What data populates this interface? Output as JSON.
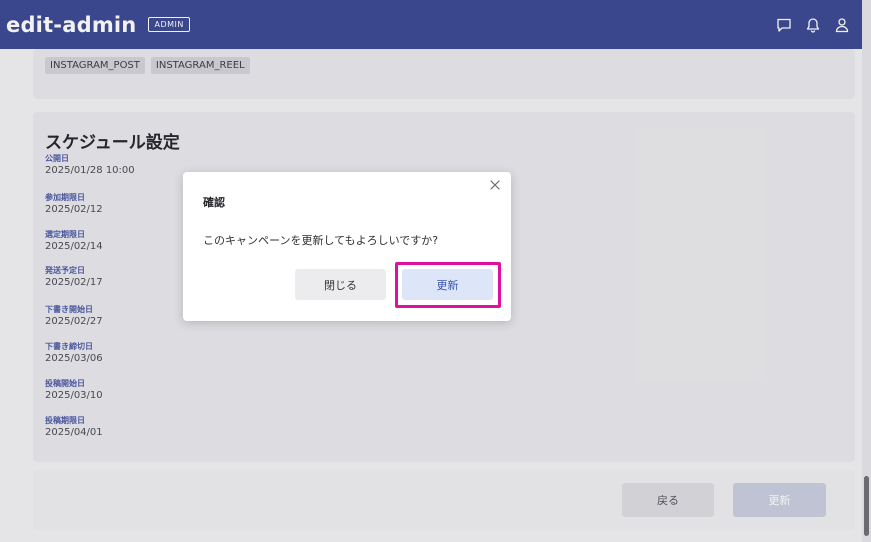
{
  "header": {
    "title": "edit-admin",
    "badge": "ADMIN",
    "icons": [
      "chat-icon",
      "bell-icon",
      "user-icon"
    ]
  },
  "tags": [
    "INSTAGRAM_POST",
    "INSTAGRAM_REEL"
  ],
  "schedule": {
    "title": "スケジュール設定",
    "fields": [
      {
        "label": "公開日",
        "value": "2025/01/28 10:00"
      },
      {
        "label": "参加期限日",
        "value": "2025/02/12"
      },
      {
        "label": "選定期限日",
        "value": "2025/02/14"
      },
      {
        "label": "発送予定日",
        "value": "2025/02/17"
      },
      {
        "label": "下書き開始日",
        "value": "2025/02/27"
      },
      {
        "label": "下書き締切日",
        "value": "2025/03/06"
      },
      {
        "label": "投稿開始日",
        "value": "2025/03/10"
      },
      {
        "label": "投稿期限日",
        "value": "2025/04/01"
      }
    ]
  },
  "footer": {
    "back_label": "戻る",
    "update_label": "更新"
  },
  "modal": {
    "title": "確認",
    "message": "このキャンペーンを更新してもよろしいですか?",
    "close_label": "閉じる",
    "confirm_label": "更新"
  },
  "colors": {
    "header_bg": "#3d4a92",
    "accent_label": "#4c5aa3",
    "highlight": "#e0109e",
    "confirm_bg": "#dde6f8"
  }
}
